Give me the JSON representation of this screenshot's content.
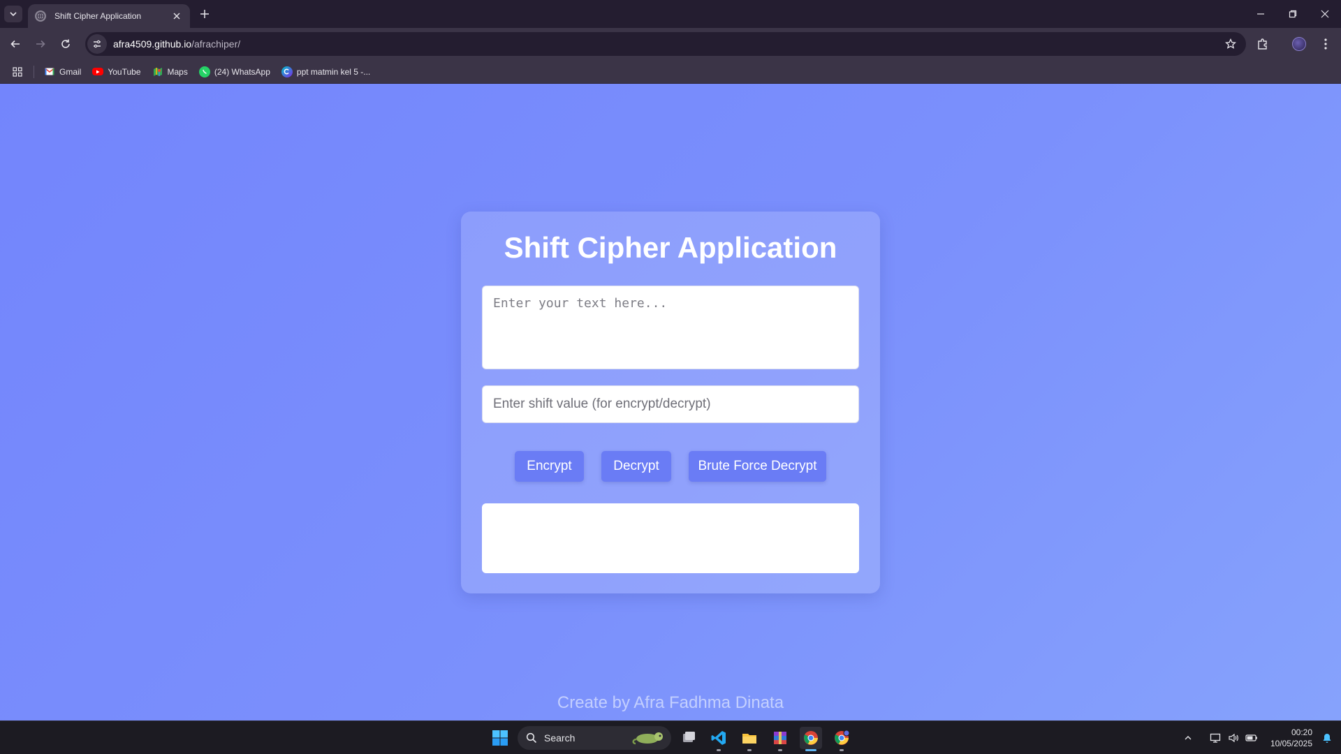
{
  "browser": {
    "tab": {
      "title": "Shift Cipher Application"
    },
    "url": {
      "domain": "afra4509.github.io",
      "path": "/afrachiper/"
    },
    "bookmarks": [
      {
        "label": "Gmail",
        "icon": "gmail-icon"
      },
      {
        "label": "YouTube",
        "icon": "youtube-icon"
      },
      {
        "label": "Maps",
        "icon": "maps-icon"
      },
      {
        "label": "(24) WhatsApp",
        "icon": "whatsapp-icon"
      },
      {
        "label": "ppt matmin kel 5 -...",
        "icon": "canva-icon"
      }
    ]
  },
  "app": {
    "title": "Shift Cipher Application",
    "text_placeholder": "Enter your text here...",
    "shift_placeholder": "Enter shift value (for encrypt/decrypt)",
    "buttons": {
      "encrypt": "Encrypt",
      "decrypt": "Decrypt",
      "brute_force": "Brute Force Decrypt"
    },
    "result": "",
    "footer": "Create by Afra Fadhma Dinata"
  },
  "taskbar": {
    "search_label": "Search",
    "time": "00:20",
    "date": "10/05/2025"
  },
  "colors": {
    "page_gradient_start": "#7385fc",
    "page_gradient_end": "#86a2fc",
    "button": "#6a7cf5",
    "browser_frame": "#3b3447"
  }
}
